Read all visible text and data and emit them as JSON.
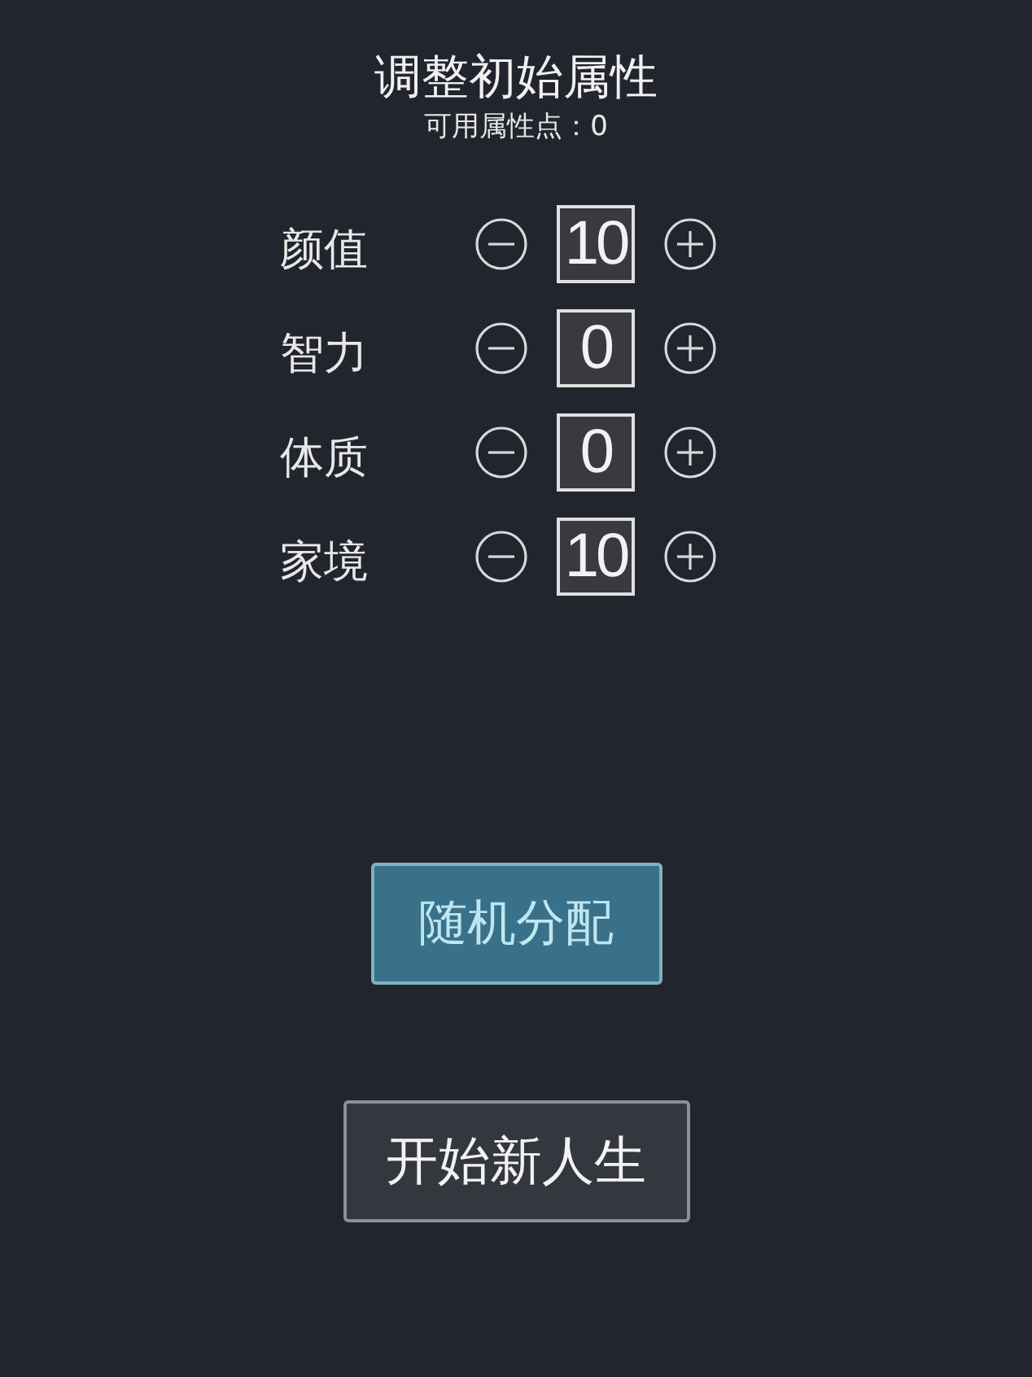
{
  "title": "调整初始属性",
  "available_points": "可用属性点：0",
  "attributes": [
    {
      "label": "颜值",
      "value": "10"
    },
    {
      "label": "智力",
      "value": "0"
    },
    {
      "label": "体质",
      "value": "0"
    },
    {
      "label": "家境",
      "value": "10"
    }
  ],
  "buttons": [
    {
      "label": "随机分配",
      "kind": "primary"
    },
    {
      "label": "开始新人生",
      "kind": "secondary"
    }
  ]
}
